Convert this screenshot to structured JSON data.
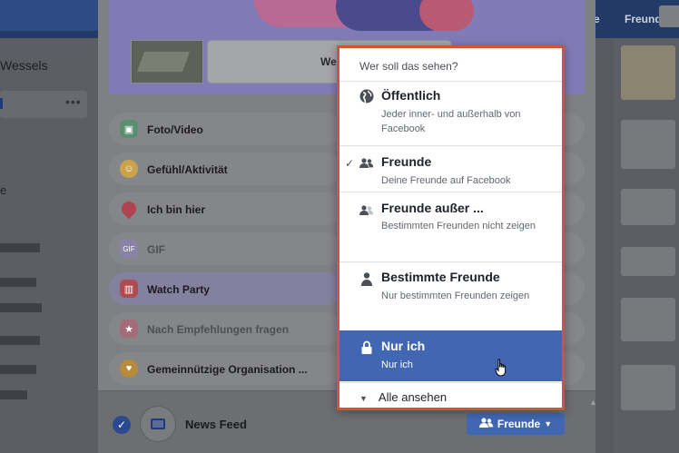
{
  "background": {
    "topbar_friends": "Freunde",
    "topbar_e": "e",
    "sidebar_user": "Wessels",
    "sidebar_more": "•••",
    "sidebar_e": "e"
  },
  "composer": {
    "continue_button": "Weit",
    "options": [
      {
        "label": "Foto/Video",
        "icon": "photo-icon",
        "color": "#5b8f6f"
      },
      {
        "label": "Gefühl/Aktivität",
        "icon": "smiley-icon",
        "color": "#c9a24a"
      },
      {
        "label": "Ich bin hier",
        "icon": "location-pin-icon",
        "color": "#b0434f"
      },
      {
        "label": "GIF",
        "icon": "gif-icon",
        "color": "#8a83a8"
      },
      {
        "label": "Watch Party",
        "icon": "popcorn-icon",
        "color": "#b24b50"
      },
      {
        "label": "Nach Empfehlungen fragen",
        "icon": "recommendation-icon",
        "color": "#a56b78"
      },
      {
        "label": "Gemeinnützige Organisation ...",
        "icon": "fundraiser-icon",
        "color": "#b88a3c"
      }
    ],
    "footer": {
      "news_feed_label": "News Feed",
      "audience_button": "Freunde"
    }
  },
  "audience_menu": {
    "header": "Wer soll das sehen?",
    "items": [
      {
        "title": "Öffentlich",
        "desc": "Jeder inner- und außerhalb von Facebook",
        "icon": "globe-icon",
        "checked": false,
        "selected": false
      },
      {
        "title": "Freunde",
        "desc": "Deine Freunde auf Facebook",
        "icon": "friends-icon",
        "checked": true,
        "selected": false
      },
      {
        "title": "Freunde außer ...",
        "desc": "Bestimmten Freunden nicht zeigen",
        "icon": "friends-except-icon",
        "checked": false,
        "selected": false
      },
      {
        "title": "Bestimmte Freunde",
        "desc": "Nur bestimmten Freunden zeigen",
        "icon": "specific-friend-icon",
        "checked": false,
        "selected": false
      },
      {
        "title": "Nur ich",
        "desc": "Nur ich",
        "icon": "lock-icon",
        "checked": false,
        "selected": true
      }
    ],
    "see_all": "Alle ansehen",
    "check_glyph": "✓",
    "accent": "#4267b2",
    "highlight_border": "#d1533f"
  }
}
